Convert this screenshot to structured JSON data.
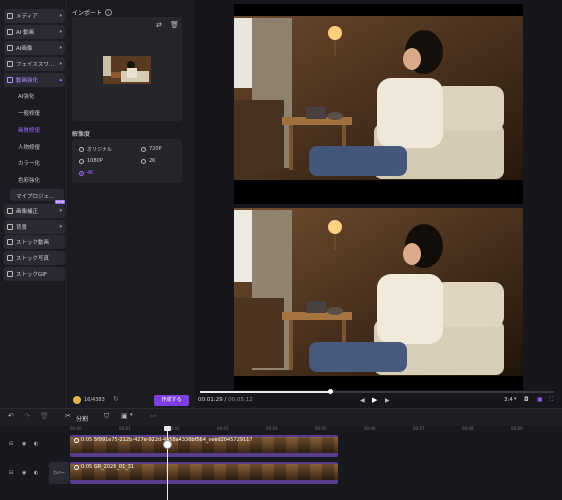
{
  "sidebar": {
    "items": [
      {
        "label": "メディア"
      },
      {
        "label": "AI 動画"
      },
      {
        "label": "AI画像"
      },
      {
        "label": "フェイススワ…"
      },
      {
        "label": "動画強化"
      }
    ],
    "sub_items": [
      "AI強化",
      "一般修復",
      "画質修復",
      "人物修復",
      "カラー化",
      "色彩強化"
    ],
    "my_preset": "マイプロジェ…",
    "lower_items": [
      {
        "label": "画像補正",
        "badge": "NEW"
      },
      {
        "label": "背景"
      },
      {
        "label": "ストック動画"
      },
      {
        "label": "ストック写真"
      },
      {
        "label": "ストックGIF"
      }
    ]
  },
  "panel": {
    "import_title": "インポート",
    "resolution_title": "解像度",
    "resolution_options": [
      "オリジナル",
      "720P",
      "1080P",
      "2K",
      "4K"
    ],
    "selected_resolution": "4K",
    "credits": "16/4383",
    "create_button": "作成する"
  },
  "player": {
    "current_time": "00:01:29",
    "total_time": "00:05:12",
    "ratio": "3:4",
    "progress": 0.58
  },
  "toolbar": {
    "split_label": "分割"
  },
  "timeline": {
    "ruler_ticks": [
      "00:00",
      "00:01",
      "00:02",
      "00:03",
      "00:04",
      "00:05",
      "00:06",
      "00:07",
      "00:08",
      "00:09"
    ],
    "track1": {
      "label": "0:05 5f991e75-212b-427e-922d-4a58a4336bf564_veed2045729117"
    },
    "track2": {
      "label": "0:05 GR_2026_01_31"
    },
    "cover_label": "カバー"
  },
  "colors": {
    "accent": "#9b6bff",
    "track": "#5a3c8f",
    "button": "#7b3fe4"
  }
}
